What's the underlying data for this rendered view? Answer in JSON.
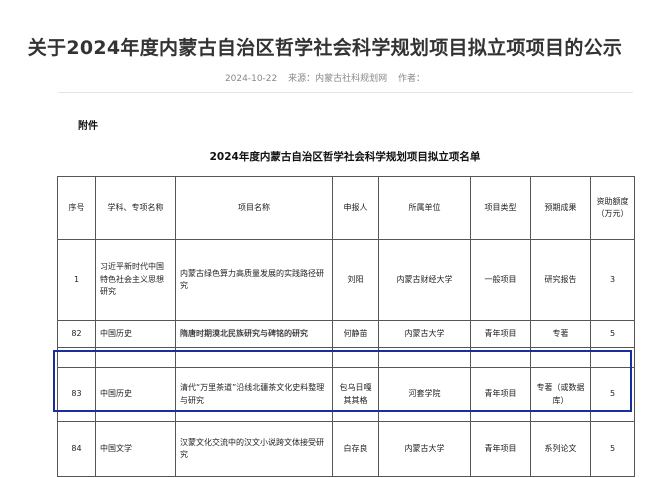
{
  "article": {
    "title": "关于2024年度内蒙古自治区哲学社会科学规划项目拟立项项目的公示",
    "date": "2024-10-22",
    "source": "来源：内蒙古社科规划网",
    "author": "作者："
  },
  "attachment_label": "附件",
  "table": {
    "title": "2024年度内蒙古自治区哲学社会科学规划项目拟立项名单",
    "headers": {
      "no": "序号",
      "discipline": "学科、专项名称",
      "project": "项目名称",
      "applicant": "申报人",
      "unit": "所属单位",
      "type": "项目类型",
      "outcome": "预期成果",
      "amount_line1": "资助额度",
      "amount_line2": "（万元）"
    },
    "rows": [
      {
        "no": "1",
        "discipline": "习近平新时代中国特色社会主义思想研究",
        "project": "内蒙古绿色算力高质量发展的实践路径研究",
        "applicant": "刘阳",
        "unit": "内蒙古财经大学",
        "type": "一般项目",
        "outcome": "研究报告",
        "amount": "3"
      },
      {
        "no": "82",
        "discipline": "中国历史",
        "project": "隋唐时期漠北民族研究与碑铭的研究",
        "applicant": "何静苗",
        "unit": "内蒙古大学",
        "type": "青年项目",
        "outcome": "专著",
        "amount": "5"
      },
      {
        "no": "83",
        "discipline": "中国历史",
        "project": "清代“万里茶道”沿线北疆茶文化史料整理与研究",
        "applicant": "包乌日嘎其其格",
        "unit": "河套学院",
        "type": "青年项目",
        "outcome": "专著（或数据库）",
        "amount": "5"
      },
      {
        "no": "84",
        "discipline": "中国文学",
        "project": "汉蒙文化交流中的汉文小说跨文体接受研究",
        "applicant": "白存良",
        "unit": "内蒙古大学",
        "type": "青年项目",
        "outcome": "系列论文",
        "amount": "5"
      }
    ]
  },
  "colors": {
    "highlight_border": "#1a2f9e"
  }
}
